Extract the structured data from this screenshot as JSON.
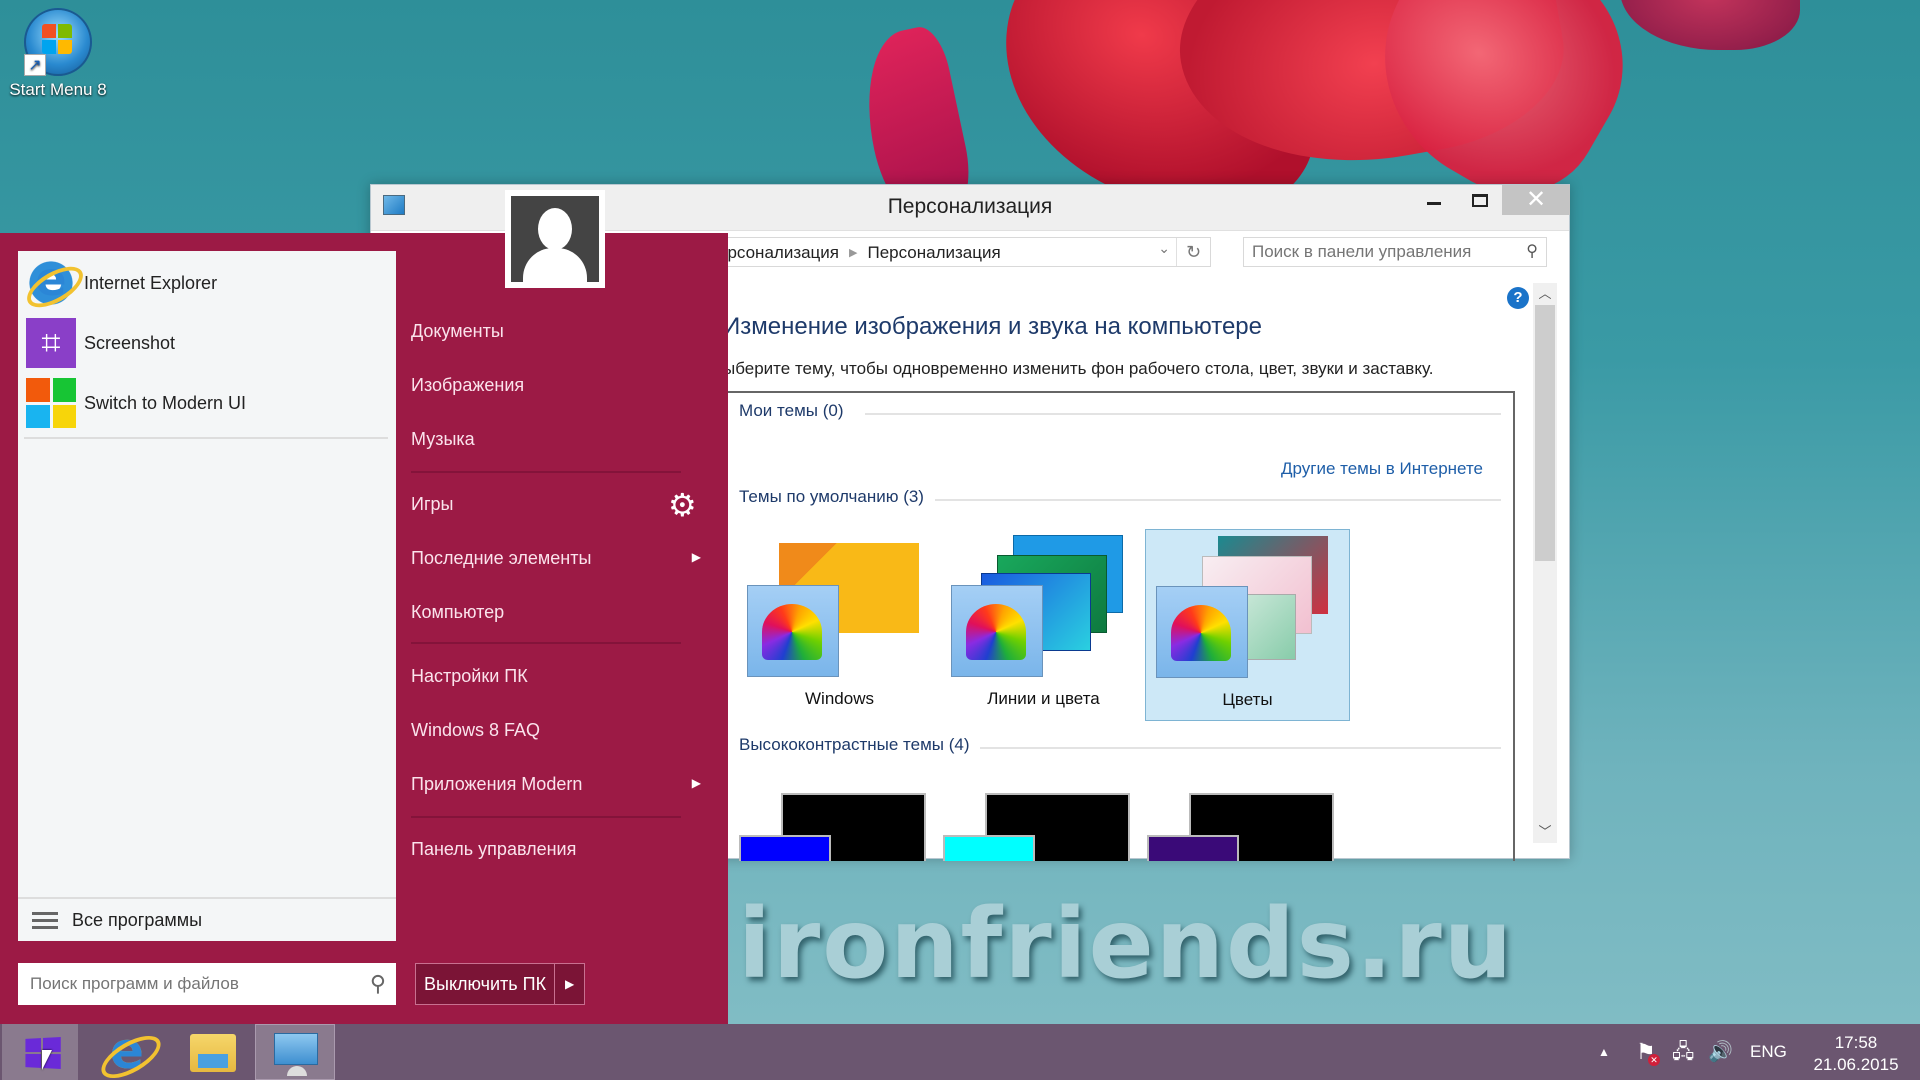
{
  "desktop": {
    "icons": [
      {
        "label": "Start Menu 8",
        "icon": "windows-orb-shortcut-icon"
      }
    ],
    "watermark": "ironfriends.ru"
  },
  "window": {
    "title": "Персонализация",
    "breadcrumb": [
      "ерсонализация",
      "Персонализация"
    ],
    "search_placeholder": "Поиск в панели управления",
    "heading": "Изменение изображения и звука на компьютере",
    "subheading": "ыберите тему, чтобы одновременно изменить фон рабочего стола, цвет, звуки и заставку.",
    "groups": {
      "my_themes": "Мои темы (0)",
      "more_link": "Другие темы в Интернете",
      "default_themes": "Темы по умолчанию (3)",
      "high_contrast": "Высококонтрастные темы (4)"
    },
    "themes": [
      {
        "label": "Windows",
        "selected": false,
        "colors": [
          "#f9b917",
          "#f08a1a"
        ]
      },
      {
        "label": "Линии и цвета",
        "selected": false,
        "colors": [
          "#1f8fe0",
          "#1aa860"
        ]
      },
      {
        "label": "Цветы",
        "selected": true,
        "colors": [
          "#f6e6ee",
          "#2a9aa0"
        ]
      }
    ],
    "high_contrast_accents": [
      "#0000ff",
      "#00ffff",
      "#3a0a78"
    ],
    "scroll_position": 0.0
  },
  "startmenu": {
    "accent": "#9c1a45",
    "pinned_apps": [
      {
        "label": "Internet Explorer",
        "icon": "internet-explorer-icon"
      },
      {
        "label": "Screenshot",
        "icon": "crop-icon"
      },
      {
        "label": "Switch to Modern UI",
        "icon": "modern-ui-tiles-icon"
      }
    ],
    "all_programs": "Все программы",
    "search_placeholder": "Поиск программ и файлов",
    "shutdown_label": "Выключить ПК",
    "right_items": [
      {
        "label": "Документы",
        "submenu": false
      },
      {
        "label": "Изображения",
        "submenu": false
      },
      {
        "label": "Музыка",
        "submenu": false
      },
      {
        "label": "Игры",
        "submenu": false
      },
      {
        "label": "Последние элементы",
        "submenu": true
      },
      {
        "label": "Компьютер",
        "submenu": false
      },
      {
        "label": "Настройки ПК",
        "submenu": false
      },
      {
        "label": "Windows 8 FAQ",
        "submenu": false
      },
      {
        "label": "Приложения Modern",
        "submenu": true
      },
      {
        "label": "Панель управления",
        "submenu": false
      }
    ]
  },
  "taskbar": {
    "pinned": [
      "start-button",
      "internet-explorer",
      "file-explorer",
      "control-panel"
    ],
    "tray": {
      "language": "ENG",
      "time": "17:58",
      "date": "21.06.2015"
    }
  }
}
